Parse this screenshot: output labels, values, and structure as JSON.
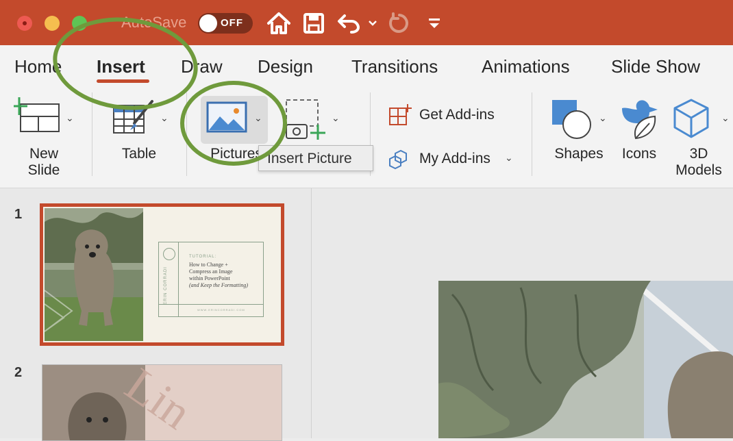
{
  "titlebar": {
    "autosave_label": "AutoSave",
    "autosave_state": "OFF",
    "colors": {
      "accent": "#c34a2c",
      "close": "#ee5a52",
      "minimize": "#f5be4f",
      "maximize": "#5fc454"
    },
    "icons": [
      "home-icon",
      "save-icon",
      "undo-icon",
      "redo-icon",
      "customize-toolbar-icon"
    ]
  },
  "tabs": [
    {
      "label": "Home"
    },
    {
      "label": "Insert",
      "active": true
    },
    {
      "label": "Draw"
    },
    {
      "label": "Design"
    },
    {
      "label": "Transitions"
    },
    {
      "label": "Animations"
    },
    {
      "label": "Slide Show"
    }
  ],
  "toolbar": {
    "new_slide": {
      "line1": "New",
      "line2": "Slide"
    },
    "table": "Table",
    "pictures": "Pictures",
    "get_addins": "Get Add-ins",
    "my_addins": "My Add-ins",
    "shapes": "Shapes",
    "icons": "Icons",
    "models": {
      "line1": "3D",
      "line2": "Models"
    }
  },
  "tooltip": "Insert Picture",
  "slides": [
    {
      "number": "1",
      "selected": true,
      "side_text": "ERIN CORRADI",
      "eyebrow": "TUTORIAL:",
      "title_lines": [
        "How to Change +",
        "Compress an Image",
        "within PowerPoint"
      ],
      "subtitle": "(and Keep the Formatting)",
      "footer": "WWW.ERINCORRADI.COM"
    },
    {
      "number": "2",
      "selected": false,
      "overlay_text": "Lin"
    }
  ],
  "annotation_color": "#6f9a3c"
}
